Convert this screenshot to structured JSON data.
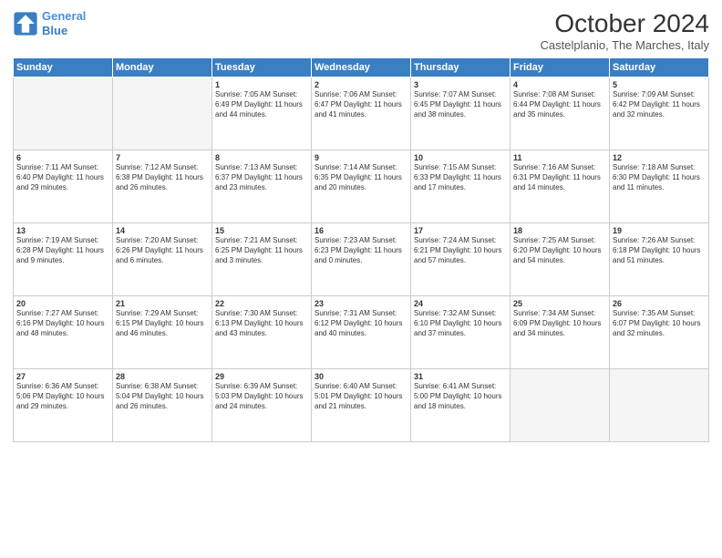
{
  "logo": {
    "line1": "General",
    "line2": "Blue"
  },
  "title": "October 2024",
  "subtitle": "Castelplanio, The Marches, Italy",
  "days_of_week": [
    "Sunday",
    "Monday",
    "Tuesday",
    "Wednesday",
    "Thursday",
    "Friday",
    "Saturday"
  ],
  "weeks": [
    [
      {
        "day": "",
        "info": "",
        "empty": true
      },
      {
        "day": "",
        "info": "",
        "empty": true
      },
      {
        "day": "1",
        "info": "Sunrise: 7:05 AM\nSunset: 6:49 PM\nDaylight: 11 hours and 44 minutes."
      },
      {
        "day": "2",
        "info": "Sunrise: 7:06 AM\nSunset: 6:47 PM\nDaylight: 11 hours and 41 minutes."
      },
      {
        "day": "3",
        "info": "Sunrise: 7:07 AM\nSunset: 6:45 PM\nDaylight: 11 hours and 38 minutes."
      },
      {
        "day": "4",
        "info": "Sunrise: 7:08 AM\nSunset: 6:44 PM\nDaylight: 11 hours and 35 minutes."
      },
      {
        "day": "5",
        "info": "Sunrise: 7:09 AM\nSunset: 6:42 PM\nDaylight: 11 hours and 32 minutes."
      }
    ],
    [
      {
        "day": "6",
        "info": "Sunrise: 7:11 AM\nSunset: 6:40 PM\nDaylight: 11 hours and 29 minutes."
      },
      {
        "day": "7",
        "info": "Sunrise: 7:12 AM\nSunset: 6:38 PM\nDaylight: 11 hours and 26 minutes."
      },
      {
        "day": "8",
        "info": "Sunrise: 7:13 AM\nSunset: 6:37 PM\nDaylight: 11 hours and 23 minutes."
      },
      {
        "day": "9",
        "info": "Sunrise: 7:14 AM\nSunset: 6:35 PM\nDaylight: 11 hours and 20 minutes."
      },
      {
        "day": "10",
        "info": "Sunrise: 7:15 AM\nSunset: 6:33 PM\nDaylight: 11 hours and 17 minutes."
      },
      {
        "day": "11",
        "info": "Sunrise: 7:16 AM\nSunset: 6:31 PM\nDaylight: 11 hours and 14 minutes."
      },
      {
        "day": "12",
        "info": "Sunrise: 7:18 AM\nSunset: 6:30 PM\nDaylight: 11 hours and 11 minutes."
      }
    ],
    [
      {
        "day": "13",
        "info": "Sunrise: 7:19 AM\nSunset: 6:28 PM\nDaylight: 11 hours and 9 minutes."
      },
      {
        "day": "14",
        "info": "Sunrise: 7:20 AM\nSunset: 6:26 PM\nDaylight: 11 hours and 6 minutes."
      },
      {
        "day": "15",
        "info": "Sunrise: 7:21 AM\nSunset: 6:25 PM\nDaylight: 11 hours and 3 minutes."
      },
      {
        "day": "16",
        "info": "Sunrise: 7:23 AM\nSunset: 6:23 PM\nDaylight: 11 hours and 0 minutes."
      },
      {
        "day": "17",
        "info": "Sunrise: 7:24 AM\nSunset: 6:21 PM\nDaylight: 10 hours and 57 minutes."
      },
      {
        "day": "18",
        "info": "Sunrise: 7:25 AM\nSunset: 6:20 PM\nDaylight: 10 hours and 54 minutes."
      },
      {
        "day": "19",
        "info": "Sunrise: 7:26 AM\nSunset: 6:18 PM\nDaylight: 10 hours and 51 minutes."
      }
    ],
    [
      {
        "day": "20",
        "info": "Sunrise: 7:27 AM\nSunset: 6:16 PM\nDaylight: 10 hours and 48 minutes."
      },
      {
        "day": "21",
        "info": "Sunrise: 7:29 AM\nSunset: 6:15 PM\nDaylight: 10 hours and 46 minutes."
      },
      {
        "day": "22",
        "info": "Sunrise: 7:30 AM\nSunset: 6:13 PM\nDaylight: 10 hours and 43 minutes."
      },
      {
        "day": "23",
        "info": "Sunrise: 7:31 AM\nSunset: 6:12 PM\nDaylight: 10 hours and 40 minutes."
      },
      {
        "day": "24",
        "info": "Sunrise: 7:32 AM\nSunset: 6:10 PM\nDaylight: 10 hours and 37 minutes."
      },
      {
        "day": "25",
        "info": "Sunrise: 7:34 AM\nSunset: 6:09 PM\nDaylight: 10 hours and 34 minutes."
      },
      {
        "day": "26",
        "info": "Sunrise: 7:35 AM\nSunset: 6:07 PM\nDaylight: 10 hours and 32 minutes."
      }
    ],
    [
      {
        "day": "27",
        "info": "Sunrise: 6:36 AM\nSunset: 5:06 PM\nDaylight: 10 hours and 29 minutes."
      },
      {
        "day": "28",
        "info": "Sunrise: 6:38 AM\nSunset: 5:04 PM\nDaylight: 10 hours and 26 minutes."
      },
      {
        "day": "29",
        "info": "Sunrise: 6:39 AM\nSunset: 5:03 PM\nDaylight: 10 hours and 24 minutes."
      },
      {
        "day": "30",
        "info": "Sunrise: 6:40 AM\nSunset: 5:01 PM\nDaylight: 10 hours and 21 minutes."
      },
      {
        "day": "31",
        "info": "Sunrise: 6:41 AM\nSunset: 5:00 PM\nDaylight: 10 hours and 18 minutes."
      },
      {
        "day": "",
        "info": "",
        "empty": true
      },
      {
        "day": "",
        "info": "",
        "empty": true
      }
    ]
  ]
}
